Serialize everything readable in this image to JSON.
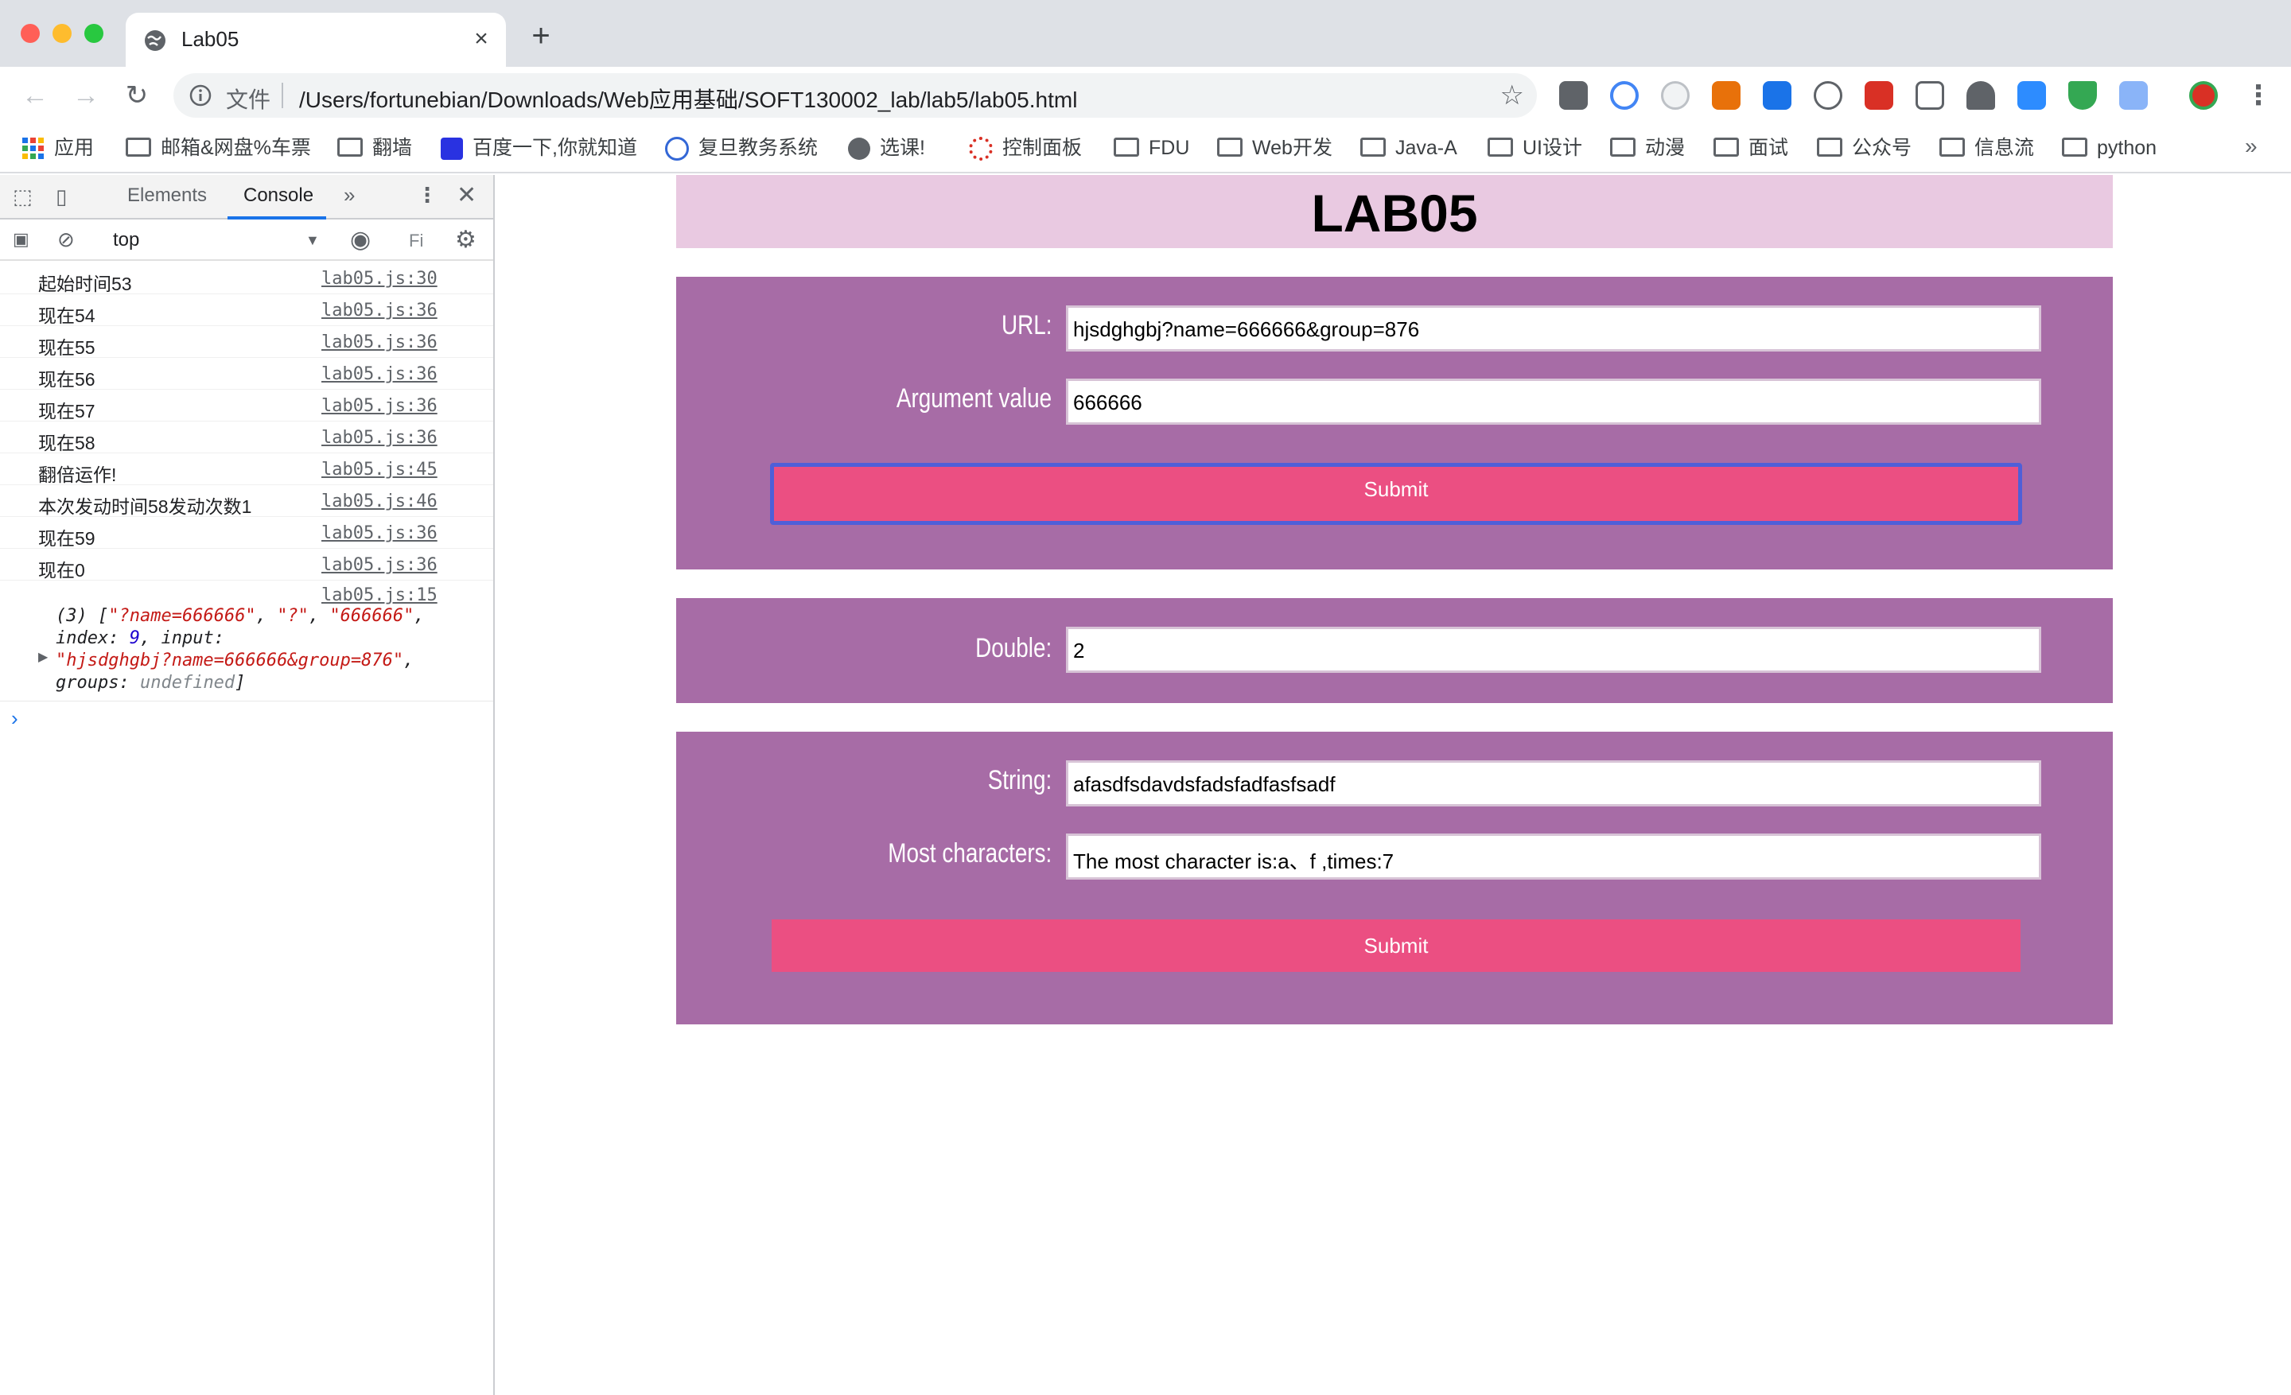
{
  "browser": {
    "tab_title": "Lab05",
    "address_protocol": "文件",
    "address_url": "/Users/fortunebian/Downloads/Web应用基础/SOFT130002_lab/lab5/lab05.html",
    "bookmarks": [
      "应用",
      "邮箱&网盘%车票",
      "翻墙",
      "百度一下,你就知道",
      "复旦教务系统",
      "选课!",
      "控制面板",
      "FDU",
      "Web开发",
      "Java-A",
      "UI设计",
      "动漫",
      "面试",
      "公众号",
      "信息流",
      "python"
    ],
    "bookmarks_more": "»"
  },
  "devtools": {
    "tabs": [
      "Elements",
      "Console"
    ],
    "more_tabs": "»",
    "context": "top",
    "filter_placeholder": "Fi",
    "logs": [
      {
        "msg": "起始时间53",
        "src": "lab05.js:30"
      },
      {
        "msg": "现在54",
        "src": "lab05.js:36"
      },
      {
        "msg": "现在55",
        "src": "lab05.js:36"
      },
      {
        "msg": "现在56",
        "src": "lab05.js:36"
      },
      {
        "msg": "现在57",
        "src": "lab05.js:36"
      },
      {
        "msg": "现在58",
        "src": "lab05.js:36"
      },
      {
        "msg": "翻倍运作!",
        "src": "lab05.js:45"
      },
      {
        "msg": "本次发动时间58发动次数1",
        "src": "lab05.js:46"
      },
      {
        "msg": "现在59",
        "src": "lab05.js:36"
      },
      {
        "msg": "现在0",
        "src": "lab05.js:36"
      }
    ],
    "object_log": {
      "src": "lab05.js:15",
      "count": "(3)",
      "items": [
        "\"?name=666666\"",
        "\"?\"",
        "\"666666\""
      ],
      "index_key": "index:",
      "index_value": "9",
      "input_key": "input:",
      "input_value": "\"hjsdghgbj?name=666666&group=876\"",
      "groups_key": "groups:",
      "groups_value": "undefined"
    },
    "prompt": "›"
  },
  "page": {
    "title": "LAB05",
    "url_label": "URL:",
    "url_value": "hjsdghgbj?name=666666&group=876",
    "arg_label": "Argument value",
    "arg_value": "666666",
    "submit1": "Submit",
    "double_label": "Double:",
    "double_value": "2",
    "string_label": "String:",
    "string_value": "afasdfsdavdsfadsfadfasfsadf",
    "most_label": "Most characters:",
    "most_value": "The most character is:a、f ,times:7",
    "submit2": "Submit"
  },
  "colors": {
    "header_bg": "#e9c9e1",
    "panel_bg": "#a76ca6",
    "button_bg": "#eb4f82",
    "focus_ring": "#4f5fd8"
  }
}
